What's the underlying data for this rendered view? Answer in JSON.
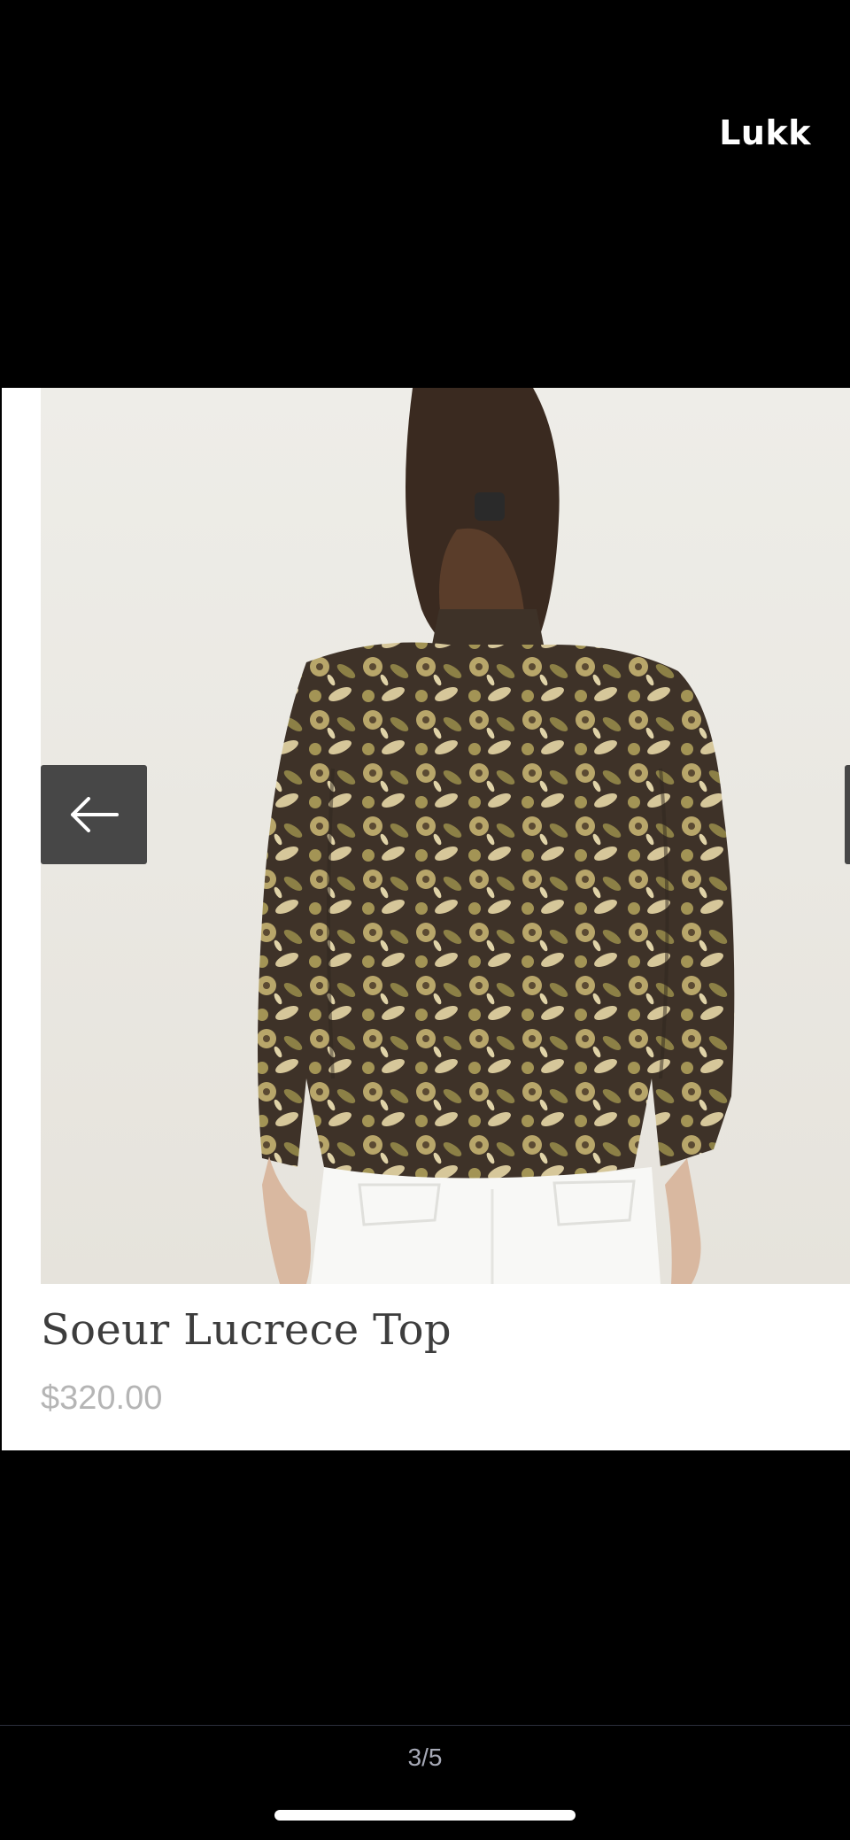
{
  "header": {
    "close_label": "Lukk"
  },
  "product": {
    "title": "Soeur Lucrece Top",
    "price": "$320.00",
    "image_icon": "product-photo"
  },
  "carousel": {
    "prev_icon": "arrow-left-icon"
  },
  "pager": {
    "text": "3/5"
  },
  "colors": {
    "background": "#000000",
    "card": "#ffffff",
    "nav_button": "#474747",
    "price": "#b5b5b5",
    "title": "#3d3d3d"
  }
}
